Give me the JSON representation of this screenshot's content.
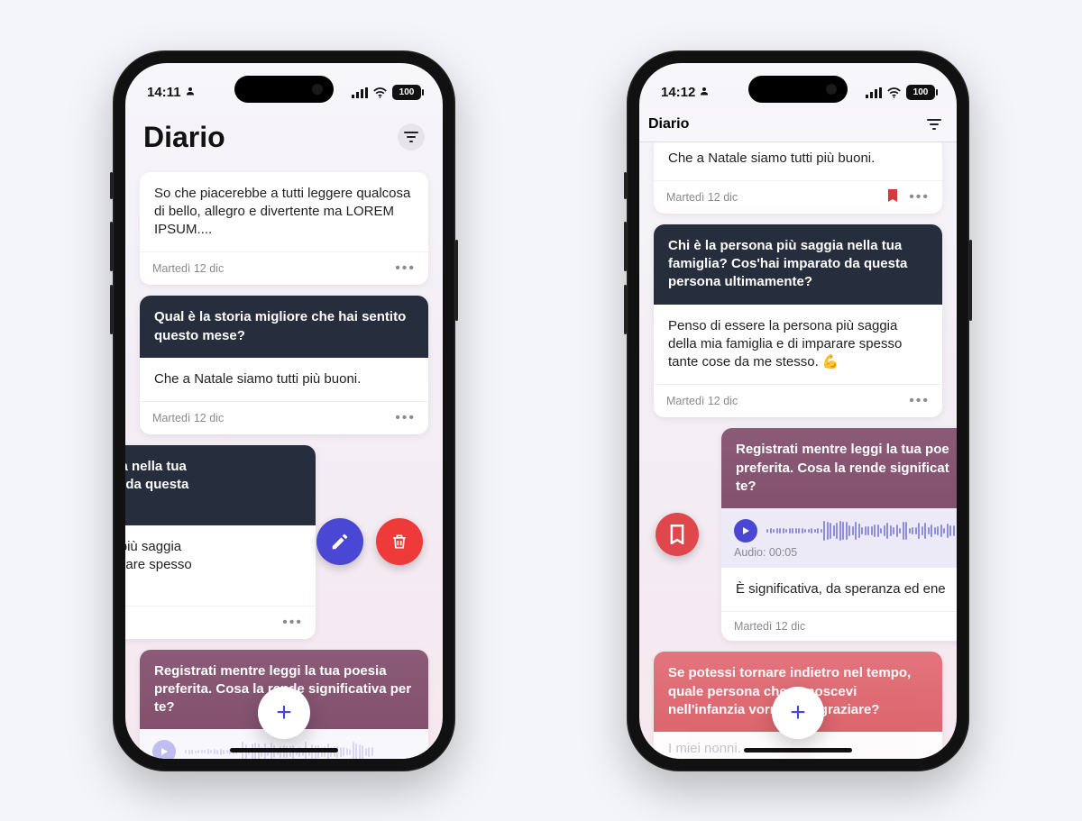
{
  "phoneA": {
    "status": {
      "time": "14:11",
      "battery": "100"
    },
    "title": "Diario",
    "entries": [
      {
        "body": "So che piacerebbe a tutti leggere qualcosa di bello, allegro e divertente ma LOREM IPSUM....",
        "date": "Martedì 12 dic"
      },
      {
        "prompt": "Qual è la storia migliore che hai sentito questo mese?",
        "body": "Che a Natale siamo tutti più buoni.",
        "date": "Martedì 12 dic"
      },
      {
        "prompt": "na più saggia nella tua\nhai imparato da questa\namente?",
        "body": "e la persona più saggia\nglia e di imparare spesso\nme stesso. 💪"
      },
      {
        "prompt": "Registrati mentre leggi la tua poesia preferita. Cosa la rende significativa per te?"
      }
    ]
  },
  "phoneB": {
    "status": {
      "time": "14:12",
      "battery": "100"
    },
    "title": "Diario",
    "entries": [
      {
        "body": "Che a Natale siamo tutti più buoni.",
        "date": "Martedì 12 dic",
        "bookmarked": true
      },
      {
        "prompt": "Chi è la persona più saggia nella tua famiglia? Cos'hai imparato da questa persona ultimamente?",
        "body": "Penso di essere la persona più saggia della mia famiglia e di imparare spesso tante cose da me stesso. 💪",
        "date": "Martedì 12 dic"
      },
      {
        "prompt": "Registrati mentre leggi la tua poe\npreferita. Cosa la rende significat\nte?",
        "audio_label": "Audio: 00:05",
        "body": "È significativa, da speranza ed ene",
        "date": "Martedì 12 dic"
      },
      {
        "prompt": "Se potessi tornare indietro nel tempo, quale persona che conoscevi nell'infanzia vorresti ringraziare?",
        "body": "I miei nonni."
      }
    ]
  }
}
